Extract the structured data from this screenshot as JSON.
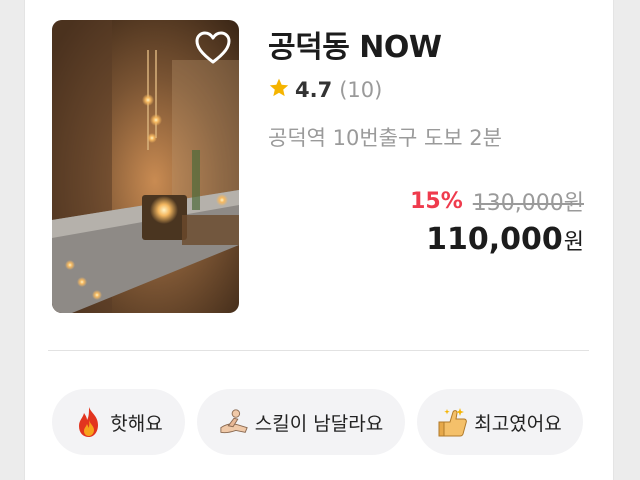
{
  "listing": {
    "name": "공덕동 NOW",
    "rating": "4.7",
    "review_count": "(10)",
    "location": "공덕역 10번출구 도보 2분",
    "discount": "15%",
    "original_price": "130,000원",
    "price": "110,000",
    "price_unit": "원",
    "favorite": false
  },
  "tags": [
    {
      "label": "핫해요",
      "icon": "fire-icon"
    },
    {
      "label": "스킬이 남달라요",
      "icon": "massage-hands-icon"
    },
    {
      "label": "최고였어요",
      "icon": "thumbs-up-icon"
    }
  ],
  "colors": {
    "discount": "#ef3b4d",
    "star": "#f5b400",
    "muted_text": "#9a9a9a",
    "tag_background": "#f3f3f5"
  }
}
